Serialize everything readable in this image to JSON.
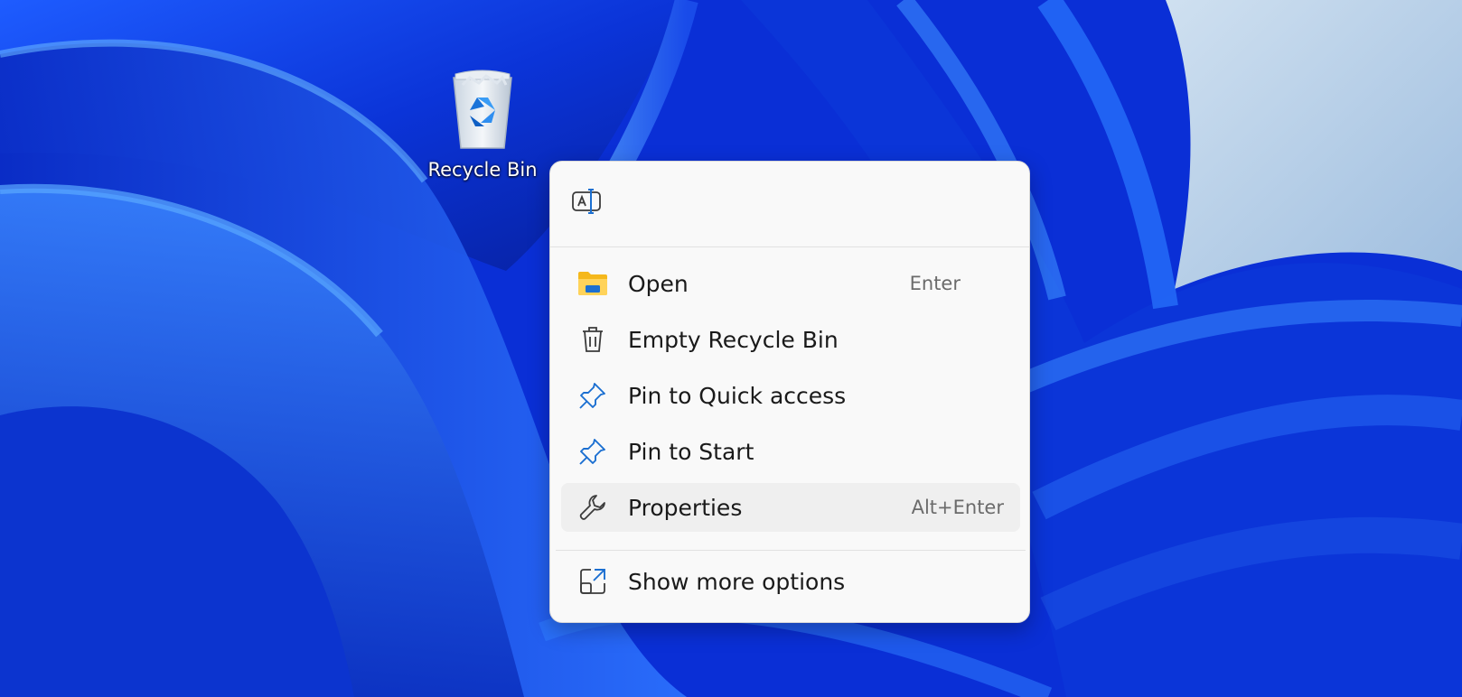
{
  "desktop": {
    "icon_label": "Recycle Bin",
    "colors": {
      "wallpaper_primary": "#0a2fd6",
      "wallpaper_light": "#3f8cff",
      "sky": "#b8d0e8"
    }
  },
  "context_menu": {
    "top_actions": [
      {
        "icon": "rename-icon"
      }
    ],
    "items": [
      {
        "label": "Open",
        "shortcut": "Enter",
        "icon": "folder-icon"
      },
      {
        "label": "Empty Recycle Bin",
        "shortcut": "",
        "icon": "trash-icon"
      },
      {
        "label": "Pin to Quick access",
        "shortcut": "",
        "icon": "pin-icon"
      },
      {
        "label": "Pin to Start",
        "shortcut": "",
        "icon": "pin-icon"
      },
      {
        "label": "Properties",
        "shortcut": "Alt+Enter",
        "icon": "wrench-icon",
        "highlighted": true
      }
    ],
    "footer_item": {
      "label": "Show more options",
      "icon": "expand-icon"
    },
    "colors": {
      "background": "#f9f9f9",
      "highlight": "#efefef",
      "pin_blue": "#1b6fd1",
      "text": "#1a1a1a",
      "shortcut_text": "#6b6b6b"
    }
  }
}
